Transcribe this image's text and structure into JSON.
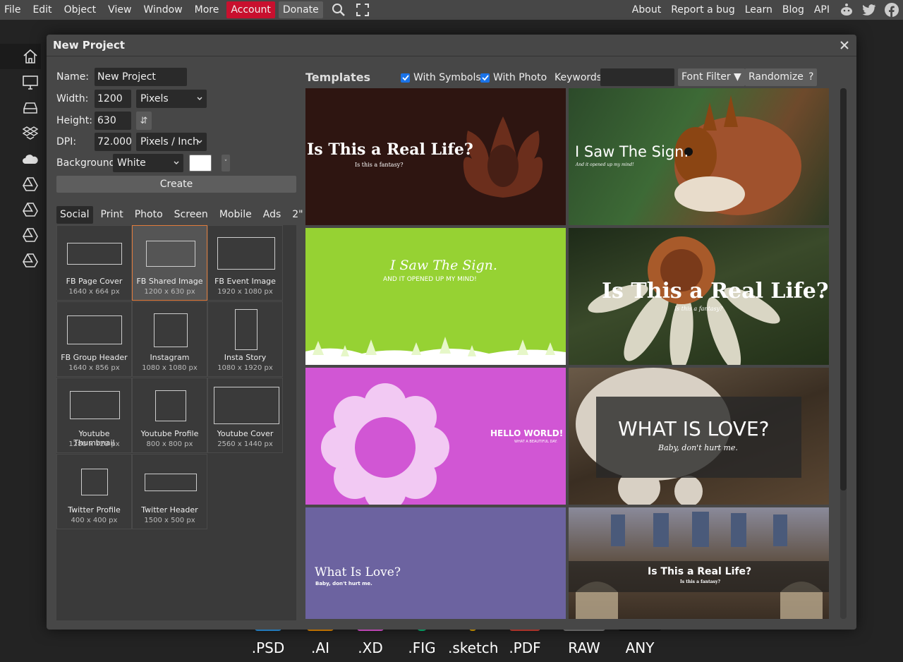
{
  "menubar": {
    "left": [
      "File",
      "Edit",
      "Object",
      "View",
      "Window",
      "More"
    ],
    "account": "Account",
    "donate": "Donate",
    "right": [
      "About",
      "Report a bug",
      "Learn",
      "Blog",
      "API"
    ]
  },
  "sidebar_icons": [
    "home-icon",
    "monitor-icon",
    "hard-drive-icon",
    "dropbox-icon",
    "onedrive-icon",
    "google-drive-icon",
    "google-drive-icon",
    "google-drive-icon",
    "google-drive-icon"
  ],
  "formats": [
    ".PSD",
    ".AI",
    ".XD",
    ".FIG",
    ".sketch",
    ".PDF",
    "RAW",
    "ANY"
  ],
  "format_colors": [
    "#31a8ff",
    "#ff9a00",
    "#ff61f6",
    "#0acf83",
    "#f7b500",
    "#e8483a",
    "#888888",
    "#111111"
  ],
  "dialog": {
    "title": "New Project",
    "form": {
      "name_label": "Name:",
      "name_value": "New Project",
      "width_label": "Width:",
      "width_value": "1200",
      "unit_value": "Pixels",
      "height_label": "Height:",
      "height_value": "630",
      "swap_glyph": "⇵",
      "dpi_label": "DPI:",
      "dpi_value": "72.000",
      "dpi_unit": "Pixels / Inch",
      "background_label": "Background:",
      "background_value": "White",
      "color_drop": "˅",
      "create_label": "Create"
    },
    "tabs": [
      "Social",
      "Print",
      "Photo",
      "Screen",
      "Mobile",
      "Ads",
      "2\""
    ],
    "presets": [
      {
        "name": "FB Page Cover",
        "size": "1640 x 664 px"
      },
      {
        "name": "FB Shared Image",
        "size": "1200 x 630 px"
      },
      {
        "name": "FB Event Image",
        "size": "1920 x 1080 px"
      },
      {
        "name": "FB Group Header",
        "size": "1640 x 856 px"
      },
      {
        "name": "Instagram",
        "size": "1080 x 1080 px"
      },
      {
        "name": "Insta Story",
        "size": "1080 x 1920 px"
      },
      {
        "name": "Youtube Thumbnail",
        "size": "1280 x 720 px"
      },
      {
        "name": "Youtube Profile",
        "size": "800 x 800 px"
      },
      {
        "name": "Youtube Cover",
        "size": "2560 x 1440 px"
      },
      {
        "name": "Twitter Profile",
        "size": "400 x 400 px"
      },
      {
        "name": "Twitter Header",
        "size": "1500 x 500 px"
      }
    ],
    "templates_header": {
      "title": "Templates",
      "with_symbols": "With Symbols",
      "with_photo": "With Photo",
      "keywords_label": "Keywords:",
      "font_filter": "Font Filter ▼",
      "randomize": "Randomize",
      "help": "?"
    },
    "templates": [
      {
        "title": "Is This a Real Life?",
        "subtitle": "Is this a fantasy?"
      },
      {
        "title": "I Saw The Sign.",
        "subtitle": "And it opened up my mind!"
      },
      {
        "title": "I Saw The Sign.",
        "subtitle": "AND IT OPENED UP MY MIND!"
      },
      {
        "title": "Is This a Real Life?",
        "subtitle": "Is this a fantasy?"
      },
      {
        "title": "HELLO WORLD!",
        "subtitle": "WHAT A BEAUTIFUL DAY."
      },
      {
        "title": "WHAT IS LOVE?",
        "subtitle": "Baby, don't hurt me."
      },
      {
        "title": "What Is Love?",
        "subtitle": "Baby, don't hurt me."
      },
      {
        "title": "Is This a Real Life?",
        "subtitle": "Is this a fantasy?"
      }
    ]
  }
}
